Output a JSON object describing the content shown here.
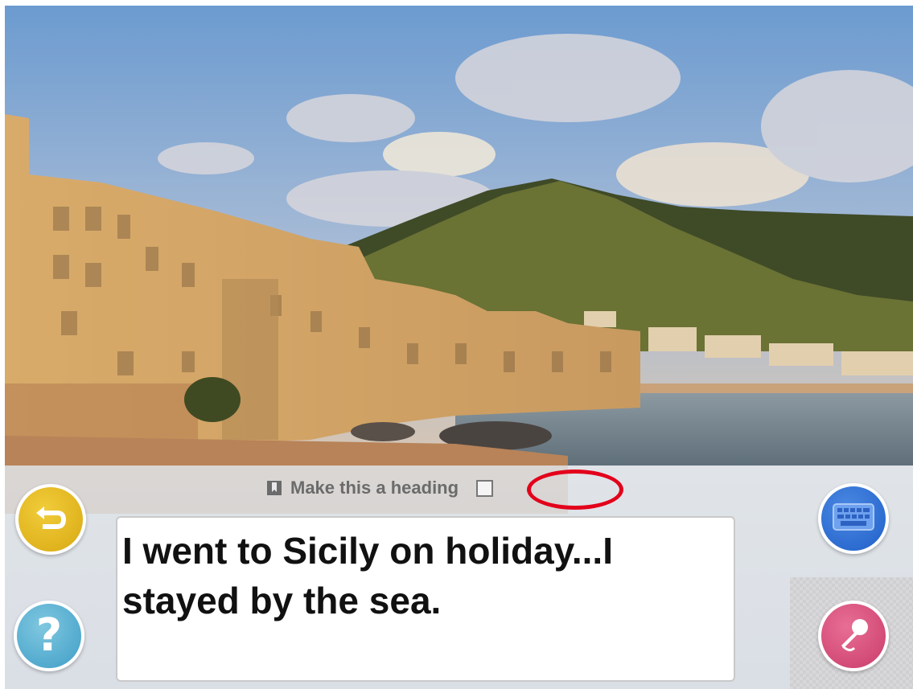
{
  "photo": {
    "subject": "coastal-town-photo",
    "colors": {
      "sky_top": "#6f9fd2",
      "sky_bottom": "#c9c2bd",
      "hill": "#5d6a2e",
      "buildings": "#d9b27a",
      "sea": "#7a8a94",
      "beach": "#b07a52"
    }
  },
  "heading_option": {
    "label": "Make this a heading",
    "icon": "bookmark-icon",
    "checked": false
  },
  "editor": {
    "text": "I went to Sicily on holiday...I stayed by the sea."
  },
  "buttons": {
    "back": {
      "icon": "undo-arrow-icon",
      "color": "#e2b41f"
    },
    "help": {
      "icon": "question-icon",
      "glyph": "?",
      "color": "#56afd3"
    },
    "keyboard": {
      "icon": "keyboard-icon",
      "color": "#2f6fd6"
    },
    "microphone": {
      "icon": "microphone-icon",
      "color": "#d64c78"
    }
  },
  "highlight": {
    "color": "#e3001b",
    "target": "heading-checkbox"
  }
}
